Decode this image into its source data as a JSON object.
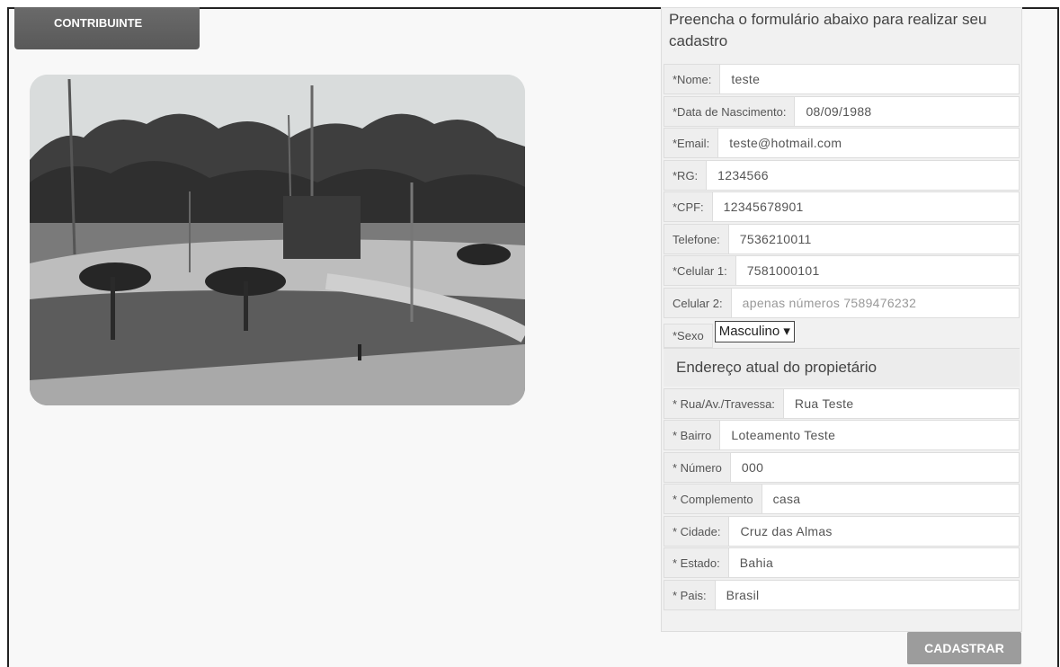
{
  "header": {
    "tab_label": "CONTRIBUINTE"
  },
  "form": {
    "intro": "Preencha o formulário abaixo para realizar seu cadastro",
    "fields": [
      {
        "label": "*Nome:",
        "value": "teste"
      },
      {
        "label": "*Data de Nascimento:",
        "value": "08/09/1988"
      },
      {
        "label": "*Email:",
        "value": "teste@hotmail.com"
      },
      {
        "label": "*RG:",
        "value": "1234566"
      },
      {
        "label": "*CPF:",
        "value": "12345678901"
      },
      {
        "label": "Telefone:",
        "value": "7536210011"
      },
      {
        "label": "*Celular 1:",
        "value": "7581000101"
      },
      {
        "label": "Celular 2:",
        "placeholder": "apenas números 7589476232"
      }
    ],
    "sexo": {
      "label": "*Sexo",
      "selected": "Masculino ▾"
    },
    "address_title": "Endereço atual do propietário",
    "address": [
      {
        "label": "* Rua/Av./Travessa:",
        "value": "Rua Teste"
      },
      {
        "label": "* Bairro",
        "value": "Loteamento Teste"
      },
      {
        "label": "* Número",
        "value": "000"
      },
      {
        "label": "* Complemento",
        "value": "casa"
      },
      {
        "label": "* Cidade:",
        "value": "Cruz das Almas"
      },
      {
        "label": "* Estado:",
        "value": "Bahia"
      },
      {
        "label": "* Pais:",
        "value": "Brasil"
      }
    ],
    "submit_label": "CADASTRAR"
  },
  "image": {
    "icon": "park-photo"
  }
}
